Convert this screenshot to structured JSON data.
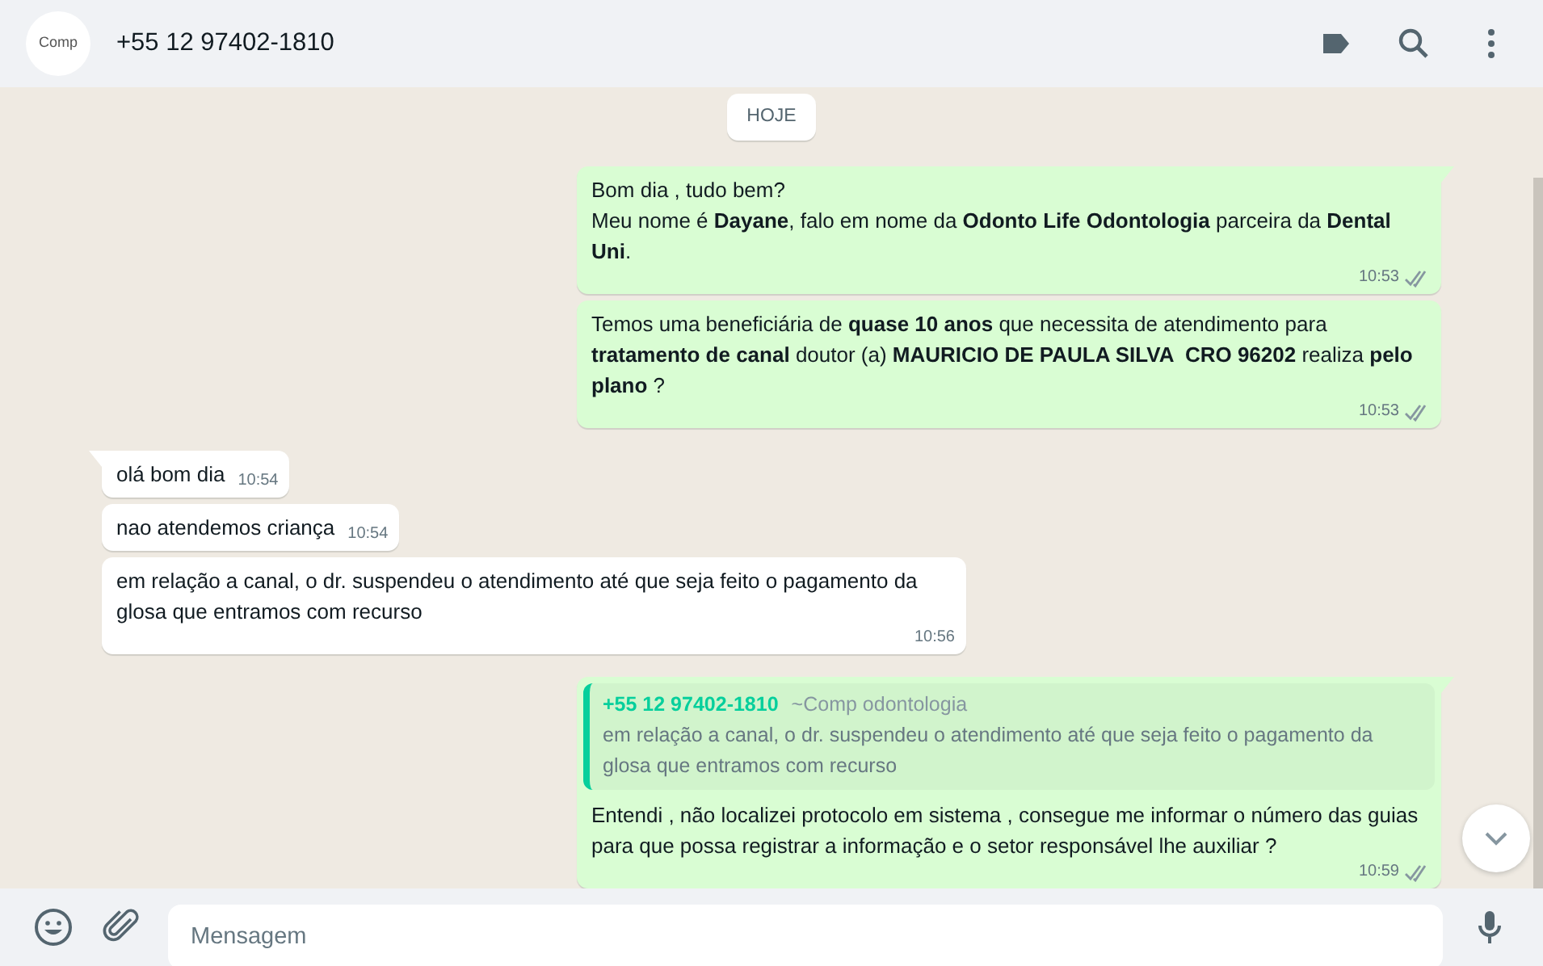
{
  "header": {
    "avatar_text": "Comp",
    "title": "+55 12 97402-1810"
  },
  "date_chip": "HOJE",
  "messages": [
    {
      "kind": "out",
      "tail": true,
      "text": "Bom dia , tudo bem?\nMeu nome é **Dayane**, falo em nome da **Odonto Life Odontologia** parceira da **Dental Uni**.",
      "time": "10:53",
      "read": false
    },
    {
      "kind": "out",
      "tail": false,
      "text": "Temos uma beneficiária de **quase 10 anos** que necessita de atendimento para **tratamento de canal** doutor (a) **MAURICIO DE PAULA SILVA  CRO 96202** realiza **pelo plano** ?",
      "time": "10:53",
      "read": false
    },
    {
      "kind": "in",
      "tail": true,
      "text": "olá bom dia",
      "time": "10:54"
    },
    {
      "kind": "in",
      "tail": false,
      "text": "nao atendemos criança",
      "time": "10:54"
    },
    {
      "kind": "in",
      "tail": false,
      "text": "em relação a canal, o dr. suspendeu o atendimento até que seja feito o pagamento da glosa que entramos com recurso",
      "time": "10:56"
    },
    {
      "kind": "out",
      "tail": true,
      "quote": {
        "author": "+55 12 97402-1810",
        "alias": "~Comp odontologia",
        "text": "em relação a canal, o dr. suspendeu o atendimento até que seja feito o pagamento da glosa que entramos com recurso"
      },
      "text": "Entendi , não localizei protocolo em sistema , consegue me informar o número das guias para que possa registrar a informação e o setor responsável lhe auxiliar ?",
      "time": "10:59",
      "read": false
    }
  ],
  "composer": {
    "placeholder": "Mensagem"
  }
}
